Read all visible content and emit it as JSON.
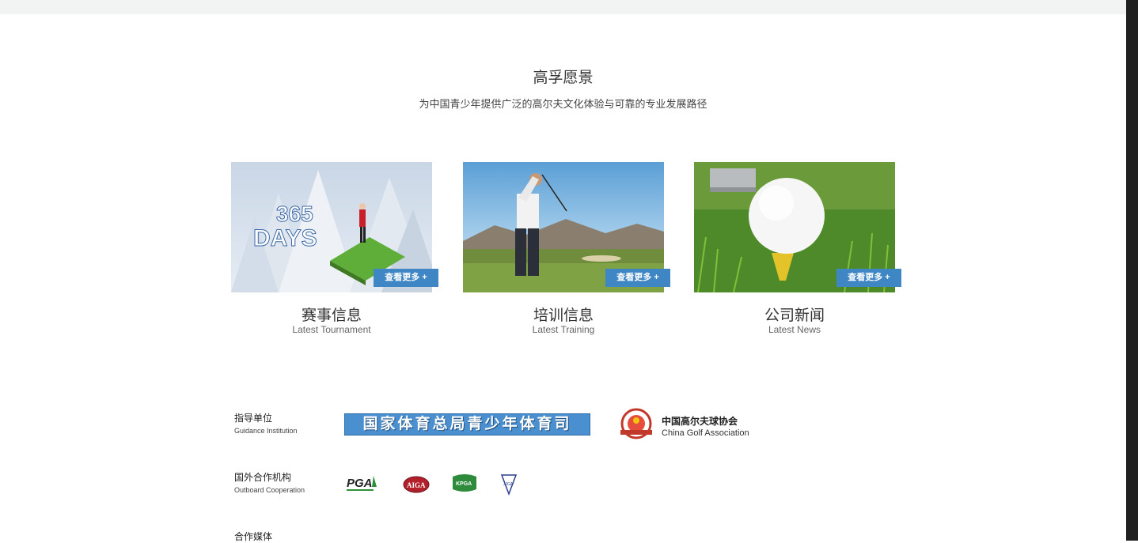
{
  "vision": {
    "title": "高孚愿景",
    "subtitle": "为中国青少年提供广泛的高尔夫文化体验与可靠的专业发展路径"
  },
  "cards": [
    {
      "title": "赛事信息",
      "subtitle": "Latest Tournament",
      "button": "查看更多 +",
      "image_text": "365 DAYS"
    },
    {
      "title": "培训信息",
      "subtitle": "Latest Training",
      "button": "查看更多 +"
    },
    {
      "title": "公司新闻",
      "subtitle": "Latest News",
      "button": "查看更多 +"
    }
  ],
  "partners": {
    "guidance": {
      "label_cn": "指导单位",
      "label_en": "Guidance Institution",
      "logos": [
        "国家体育总局青少年体育司",
        "中国高尔夫球协会",
        "China Golf Association"
      ]
    },
    "outboard": {
      "label_cn": "国外合作机构",
      "label_en": "Outboard Cooperation",
      "logos": [
        "PGA",
        "AIGA",
        "KPGA",
        "JJGA"
      ]
    },
    "media": {
      "label_cn": "合作媒体"
    }
  },
  "colors": {
    "accent": "#3f86c4",
    "topbar": "#f2f4f4"
  }
}
